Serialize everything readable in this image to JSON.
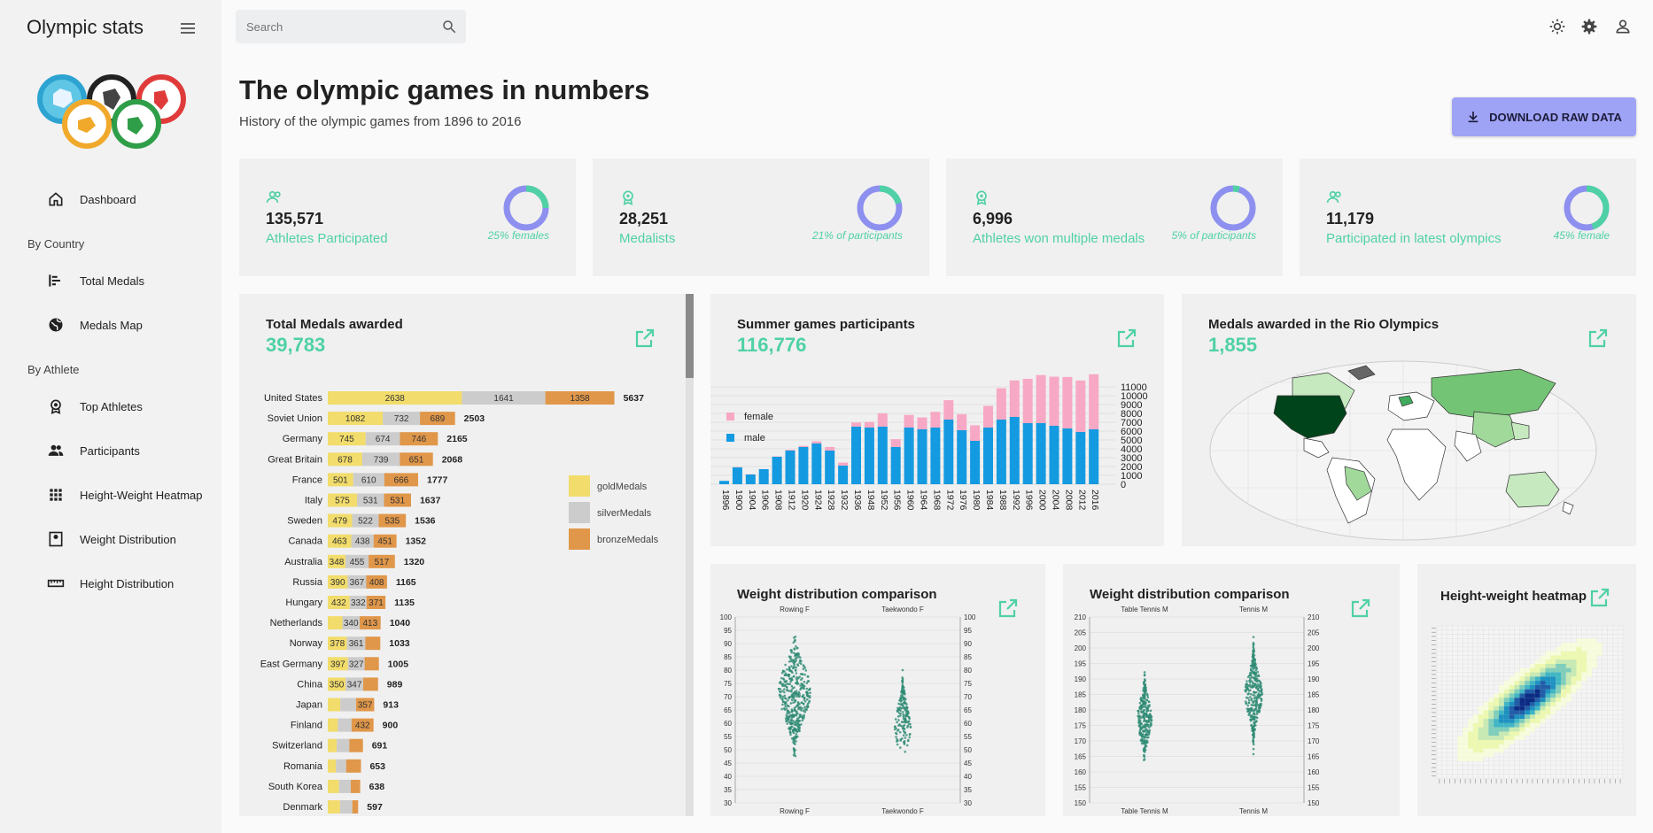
{
  "app": {
    "title": "Olympic stats"
  },
  "sidebar": {
    "items": [
      {
        "label": "Dashboard",
        "icon": "home-icon"
      },
      {
        "label": "Total Medals",
        "icon": "bar-chart-icon"
      },
      {
        "label": "Medals Map",
        "icon": "globe-icon"
      },
      {
        "label": "Top Athletes",
        "icon": "medal-icon"
      },
      {
        "label": "Participants",
        "icon": "people-icon"
      },
      {
        "label": "Height-Weight Heatmap",
        "icon": "grid-icon"
      },
      {
        "label": "Weight Distribution",
        "icon": "scale-icon"
      },
      {
        "label": "Height Distribution",
        "icon": "ruler-icon"
      }
    ],
    "headings": {
      "country": "By Country",
      "athlete": "By Athlete"
    }
  },
  "search": {
    "placeholder": "Search"
  },
  "header": {
    "title": "The olympic games in numbers",
    "subtitle": "History of the olympic games from 1896 to 2016",
    "download_label": "DOWNLOAD RAW DATA"
  },
  "stats": [
    {
      "value": "135,571",
      "label": "Athletes Participated",
      "pct_text": "25% females",
      "pct": 0.25,
      "icon": "people-icon"
    },
    {
      "value": "28,251",
      "label": "Medalists",
      "pct_text": "21% of participants",
      "pct": 0.21,
      "icon": "medal-icon"
    },
    {
      "value": "6,996",
      "label": "Athletes won multiple medals",
      "pct_text": "5% of participants",
      "pct": 0.05,
      "icon": "medal-icon"
    },
    {
      "value": "11,179",
      "label": "Participated in latest olympics",
      "pct_text": "45% female",
      "pct": 0.45,
      "icon": "people-icon"
    }
  ],
  "colors": {
    "accent": "#4fd1a5",
    "donut_main": "#8d90ef",
    "gold": "#f2dc6b",
    "silver": "#cccccc",
    "bronze": "#e0974a",
    "female": "#f7a8c5",
    "male": "#149ae0",
    "swarm": "#2e8b74",
    "button": "#9fa3f5"
  },
  "panels": {
    "medals": {
      "title": "Total Medals awarded",
      "value": "39,783"
    },
    "participants": {
      "title": "Summer games participants",
      "value": "116,776"
    },
    "rio": {
      "title": "Medals awarded in the Rio Olympics",
      "value": "1,855"
    },
    "weight1": {
      "title": "Weight distribution comparison"
    },
    "weight2": {
      "title": "Weight distribution comparison"
    },
    "heatmap": {
      "title": "Height-weight heatmap"
    }
  },
  "chart_data": [
    {
      "type": "bar",
      "title": "Total Medals awarded",
      "stacked": true,
      "orientation": "horizontal",
      "categories": [
        "United States",
        "Soviet Union",
        "Germany",
        "Great Britain",
        "France",
        "Italy",
        "Sweden",
        "Canada",
        "Australia",
        "Russia",
        "Hungary",
        "Netherlands",
        "Norway",
        "East Germany",
        "China",
        "Japan",
        "Finland",
        "Switzerland",
        "Romania",
        "South Korea",
        "Denmark"
      ],
      "series": [
        {
          "name": "goldMedals",
          "values": [
            2638,
            1082,
            745,
            678,
            501,
            575,
            479,
            463,
            348,
            390,
            432,
            287,
            378,
            397,
            350,
            247,
            198,
            176,
            161,
            221,
            241
          ]
        },
        {
          "name": "silverMedals",
          "values": [
            1641,
            732,
            674,
            739,
            610,
            531,
            522,
            438,
            455,
            367,
            332,
            340,
            361,
            327,
            347,
            309,
            270,
            248,
            200,
            232,
            241
          ]
        },
        {
          "name": "bronzeMedals",
          "values": [
            1358,
            689,
            746,
            651,
            666,
            531,
            535,
            451,
            517,
            408,
            371,
            413,
            294,
            281,
            292,
            357,
            432,
            268,
            292,
            185,
            115
          ]
        }
      ],
      "totals": [
        5637,
        2503,
        2165,
        2068,
        1777,
        1637,
        1536,
        1352,
        1320,
        1165,
        1135,
        1040,
        1033,
        1005,
        989,
        913,
        900,
        691,
        653,
        638,
        597
      ],
      "legend_position": "right"
    },
    {
      "type": "bar",
      "title": "Summer games participants",
      "stacked": true,
      "categories": [
        "1896",
        "1900",
        "1904",
        "1906",
        "1908",
        "1912",
        "1920",
        "1924",
        "1928",
        "1932",
        "1936",
        "1948",
        "1952",
        "1956",
        "1960",
        "1964",
        "1968",
        "1972",
        "1976",
        "1980",
        "1984",
        "1988",
        "1992",
        "1996",
        "2000",
        "2004",
        "2008",
        "2012",
        "2016"
      ],
      "series": [
        {
          "name": "male",
          "values": [
            380,
            1900,
            1100,
            1700,
            3100,
            3800,
            4200,
            4600,
            3800,
            2100,
            6500,
            6400,
            6500,
            4200,
            6400,
            6200,
            6400,
            7300,
            6100,
            4900,
            6400,
            7300,
            7600,
            6900,
            6900,
            6600,
            6300,
            5900,
            6200
          ]
        },
        {
          "name": "female",
          "values": [
            0,
            30,
            16,
            11,
            47,
            87,
            134,
            244,
            404,
            347,
            468,
            628,
            1497,
            893,
            1435,
            1348,
            1777,
            2193,
            1813,
            1756,
            2447,
            3543,
            4124,
            5008,
            5431,
            5546,
            5816,
            5815,
            6223
          ]
        }
      ],
      "ylim": [
        0,
        11000
      ],
      "legend_position": "top-left"
    },
    {
      "type": "scatter",
      "title": "Weight distribution comparison",
      "categories": [
        "Rowing F",
        "Taekwondo F"
      ],
      "ylim": [
        30,
        100
      ]
    },
    {
      "type": "scatter",
      "title": "Weight distribution comparison",
      "categories": [
        "Table Tennis M",
        "Tennis M"
      ],
      "ylim": [
        150,
        210
      ]
    },
    {
      "type": "heatmap",
      "title": "Height-weight heatmap"
    }
  ]
}
